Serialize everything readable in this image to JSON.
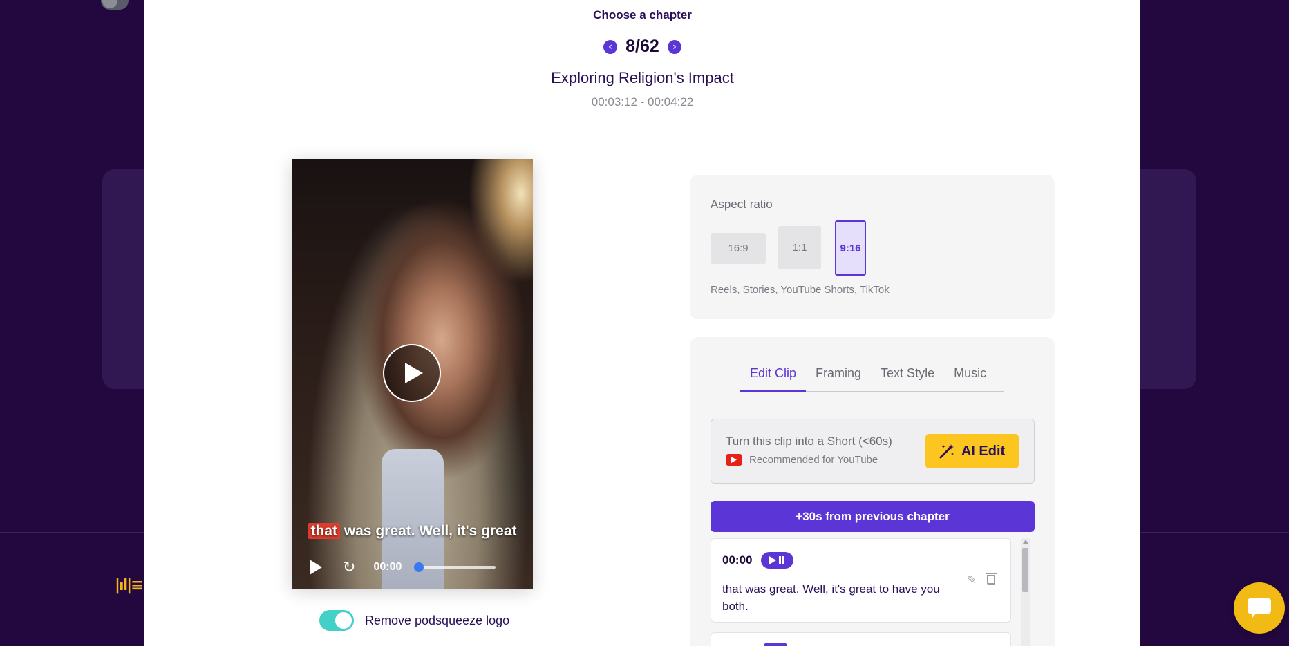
{
  "chapter": {
    "label": "Choose a chapter",
    "count": "8/62",
    "title": "Exploring Religion's Impact",
    "time_range": "00:03:12 - 00:04:22",
    "prev_icon": "chevron-left-icon",
    "next_icon": "chevron-right-icon"
  },
  "video": {
    "caption_highlight": "that",
    "caption_rest": " was great. Well, it's great",
    "current_time": "00:00",
    "progress": 0
  },
  "logo_toggle": {
    "label": "Remove podsqueeze logo",
    "checked": true
  },
  "aspect": {
    "title": "Aspect ratio",
    "options": [
      "16:9",
      "1:1",
      "9:16"
    ],
    "selected": "9:16",
    "description": "Reels, Stories, YouTube Shorts, TikTok"
  },
  "tabs": [
    {
      "label": "Edit Clip",
      "active": true
    },
    {
      "label": "Framing",
      "active": false
    },
    {
      "label": "Text Style",
      "active": false
    },
    {
      "label": "Music",
      "active": false
    }
  ],
  "ai": {
    "title": "Turn this clip into a Short (<60s)",
    "subtitle": "Recommended for YouTube",
    "button": "AI Edit"
  },
  "prev_chapter_button": "+30s from previous chapter",
  "segments": [
    {
      "time": "00:00",
      "text": "that was great. Well, it's great to have you both."
    }
  ],
  "colors": {
    "accent": "#5b35d5",
    "ai_button": "#fcc520",
    "toggle_on": "#43d1c7",
    "background": "#23073f"
  }
}
